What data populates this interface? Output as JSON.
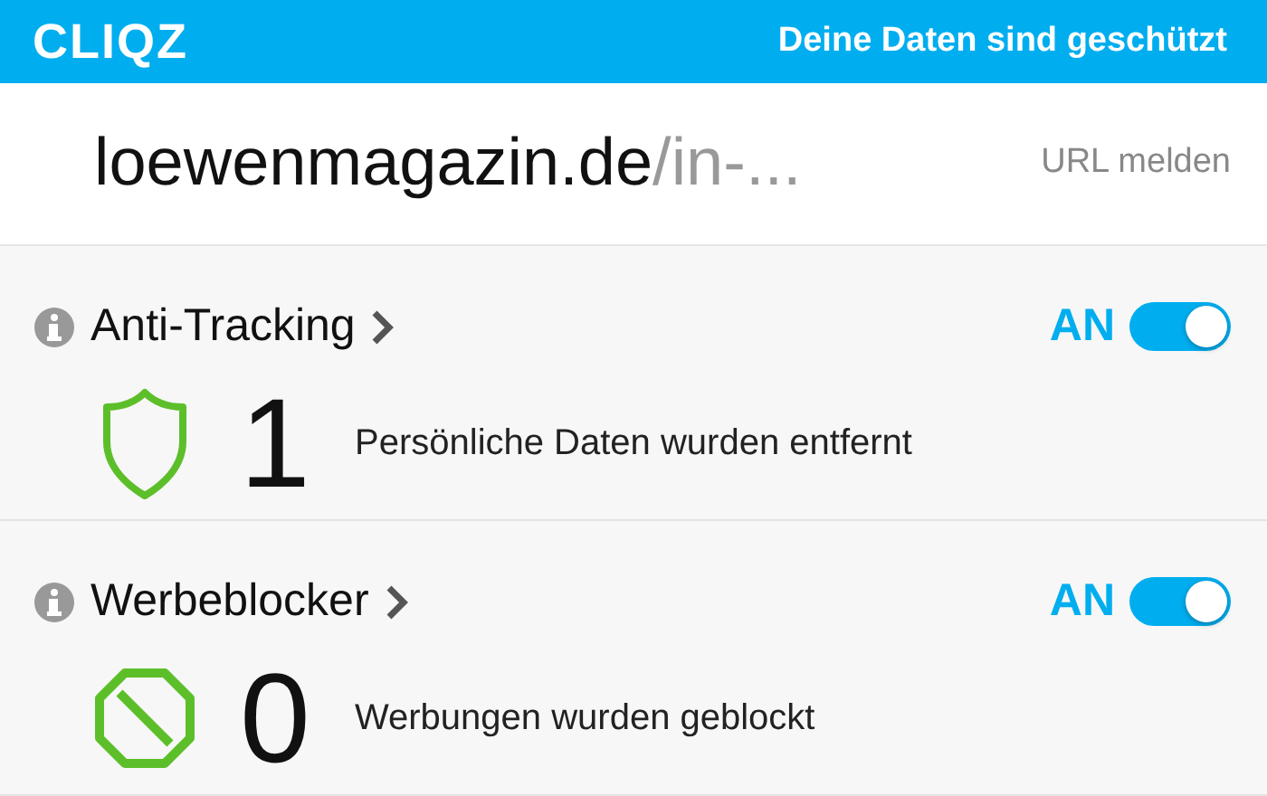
{
  "header": {
    "logo": "CLIQZ",
    "status": "Deine Daten sind geschützt"
  },
  "site": {
    "domain": "loewenmagazin.de",
    "path": "/in-...",
    "report_link": "URL melden"
  },
  "sections": [
    {
      "kind": "tracking",
      "title": "Anti-Tracking",
      "toggle_label": "AN",
      "on": true,
      "count": "1",
      "description": "Persönliche Daten wurden entfernt"
    },
    {
      "kind": "ads",
      "title": "Werbeblocker",
      "toggle_label": "AN",
      "on": true,
      "count": "0",
      "description": "Werbungen wurden geblockt"
    }
  ]
}
